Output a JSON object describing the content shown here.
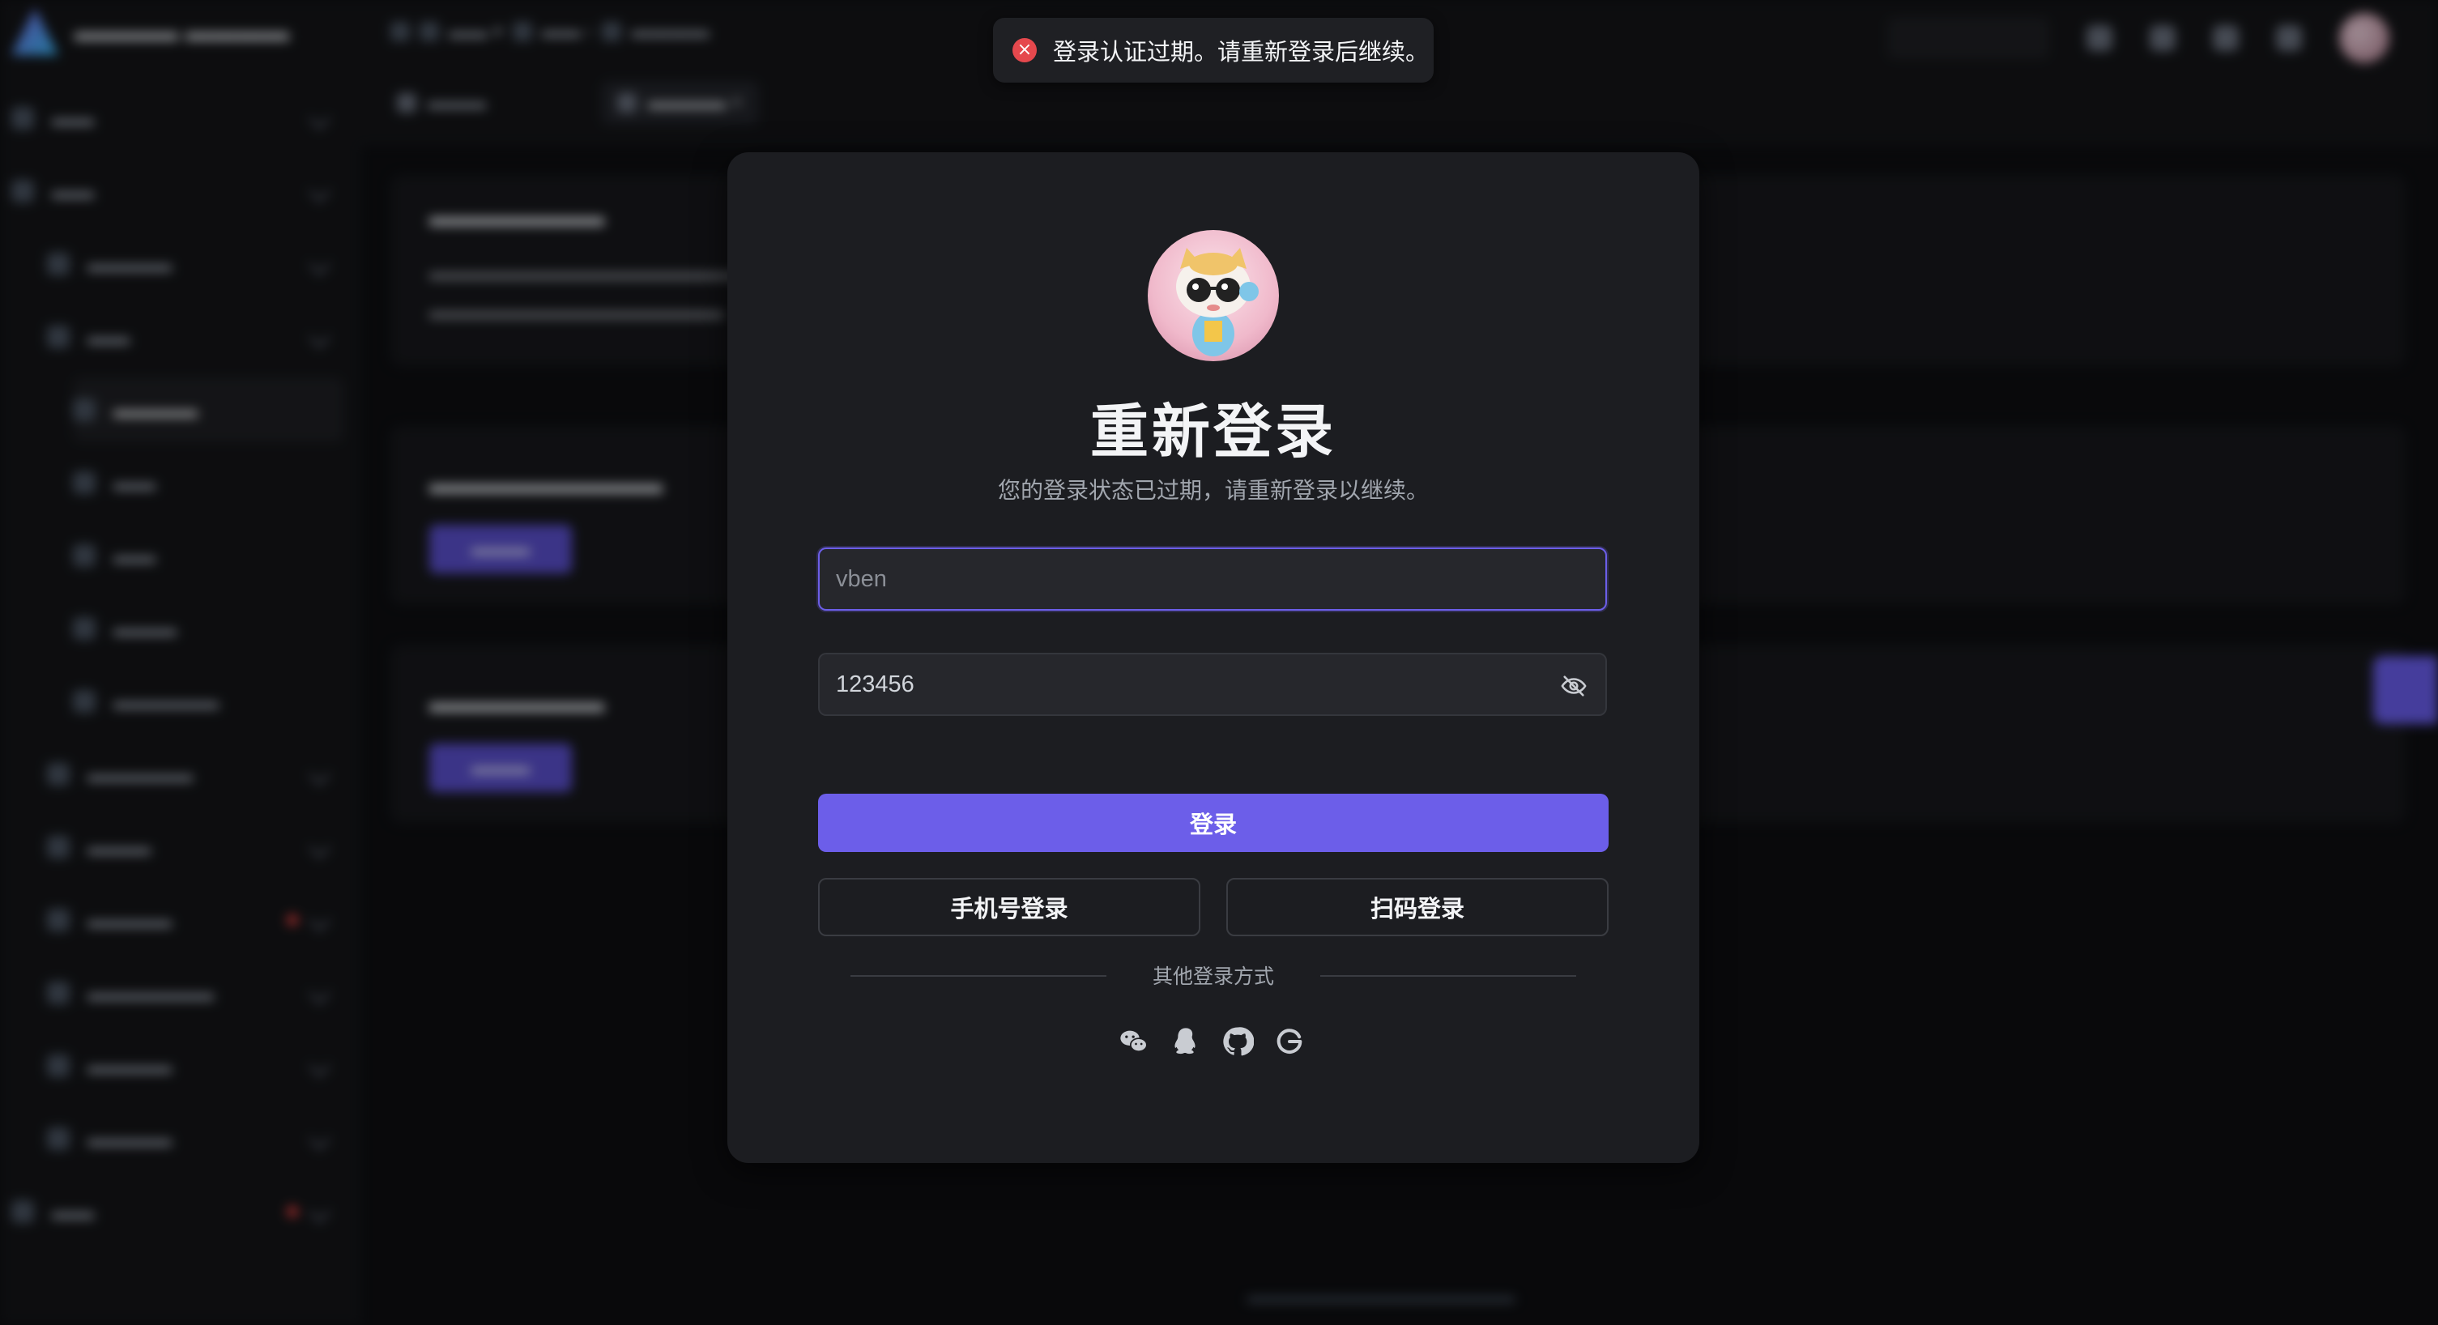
{
  "toast": {
    "icon": "close-circle-icon",
    "message": "登录认证过期。请重新登录后继续。"
  },
  "modal": {
    "title": "重新登录",
    "subtitle": "您的登录状态已过期，请重新登录以继续。",
    "username": {
      "value": "vben",
      "placeholder": "vben"
    },
    "password": {
      "value": "123456",
      "placeholder": "123456",
      "toggle_icon": "eye-off-icon"
    },
    "login_button": "登录",
    "phone_login_button": "手机号登录",
    "qrcode_login_button": "扫码登录",
    "other_methods_label": "其他登录方式",
    "social_icons": [
      "wechat-icon",
      "qq-icon",
      "github-icon",
      "google-icon"
    ]
  },
  "colors": {
    "primary": "#6c5ee9",
    "error": "#e5484d",
    "modal_bg": "#1c1d21",
    "page_bg": "#0e0f12"
  }
}
